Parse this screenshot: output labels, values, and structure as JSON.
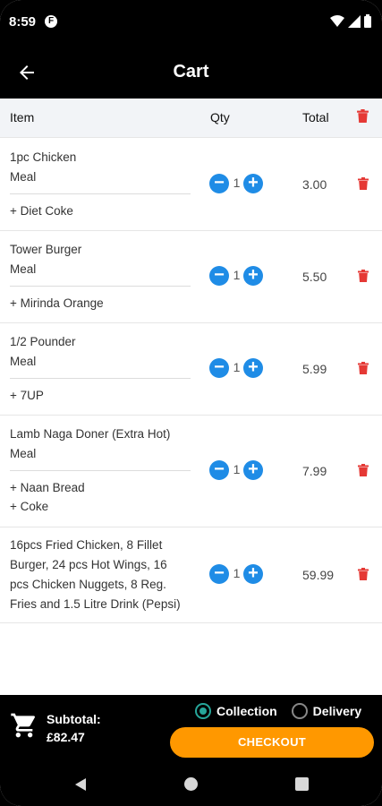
{
  "status_bar": {
    "time": "8:59",
    "notification_badge": "F"
  },
  "app_bar": {
    "title": "Cart"
  },
  "table_header": {
    "item": "Item",
    "qty": "Qty",
    "total": "Total"
  },
  "items": [
    {
      "name_line1": "1pc Chicken",
      "name_line2": "Meal",
      "extras": [
        "+ Diet Coke"
      ],
      "qty": "1",
      "total": "3.00"
    },
    {
      "name_line1": "Tower Burger",
      "name_line2": "Meal",
      "extras": [
        "+ Mirinda Orange"
      ],
      "qty": "1",
      "total": "5.50"
    },
    {
      "name_line1": "1/2 Pounder",
      "name_line2": "Meal",
      "extras": [
        "+ 7UP"
      ],
      "qty": "1",
      "total": "5.99"
    },
    {
      "name_line1": "Lamb Naga Doner (Extra Hot)",
      "name_line2": "Meal",
      "extras": [
        "+ Naan Bread",
        "+ Coke"
      ],
      "qty": "1",
      "total": "7.99"
    },
    {
      "name_lines": [
        "16pcs Fried Chicken, 8 Fillet",
        "Burger, 24 pcs Hot Wings, 16",
        "pcs Chicken Nuggets, 8 Reg.",
        "Fries and 1.5 Litre Drink (Pepsi)"
      ],
      "qty": "1",
      "total": "59.99"
    }
  ],
  "footer": {
    "subtotal_label": "Subtotal:",
    "subtotal_value": "£82.47",
    "option_collection": "Collection",
    "option_delivery": "Delivery",
    "selected_option": "Collection",
    "checkout_label": "CHECKOUT"
  },
  "colors": {
    "accent_blue": "#1f8ce6",
    "checkout_orange": "#ff9800",
    "delete_red": "#e53935",
    "radio_teal": "#26a69a"
  },
  "icons": {
    "back": "arrow-left-icon",
    "delete": "trash-icon",
    "cart": "shopping-cart-icon"
  }
}
